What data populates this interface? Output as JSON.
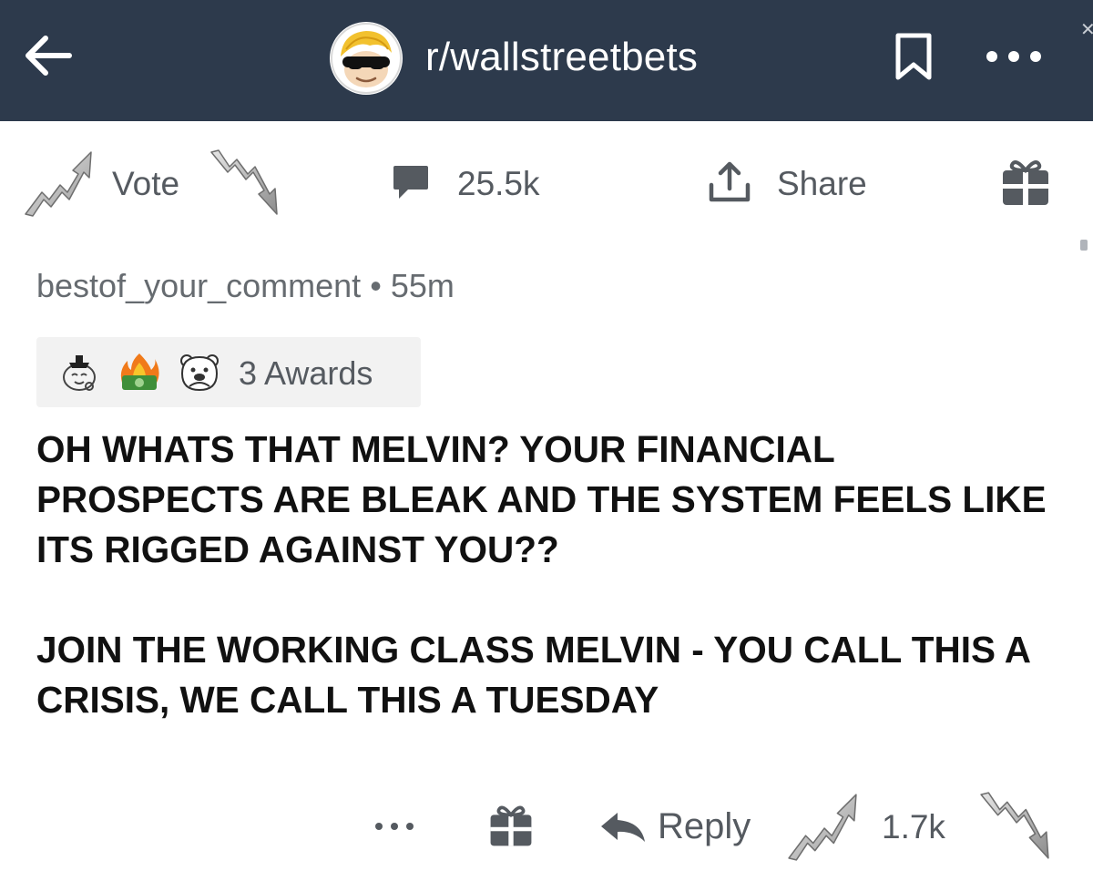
{
  "header": {
    "subreddit": "r/wallstreetbets",
    "back_icon": "arrow-left-icon",
    "avatar_icon": "subreddit-avatar-icon",
    "bookmark_icon": "bookmark-icon",
    "more_icon": "more-dots-icon",
    "background": "#2d3a4c"
  },
  "actions": {
    "vote_label": "Vote",
    "comment_count": "25.5k",
    "share_label": "Share"
  },
  "comment": {
    "author": "bestof_your_comment",
    "separator": "•",
    "age": "55m",
    "awards_label": "3 Awards",
    "award_icons": [
      "wholesome-seal-icon",
      "money-fire-icon",
      "bear-face-icon"
    ],
    "paragraphs": [
      "OH WHATS THAT MELVIN? YOUR FINANCIAL PROSPECTS ARE BLEAK AND THE SYSTEM FEELS LIKE ITS RIGGED AGAINST YOU??",
      "JOIN THE WORKING CLASS MELVIN - YOU CALL THIS A CRISIS, WE CALL THIS A TUESDAY"
    ]
  },
  "footer": {
    "reply_label": "Reply",
    "score": "1.7k"
  }
}
